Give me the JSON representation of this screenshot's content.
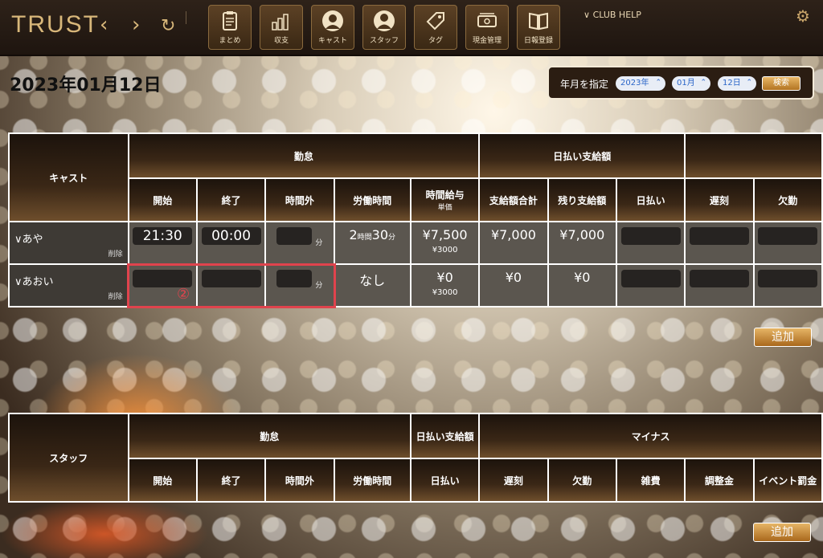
{
  "app": {
    "logo": "TRUST",
    "back": "‹",
    "forward": "›",
    "reload": "↻",
    "help": "CLUB HELP"
  },
  "toolbar": [
    {
      "label": "まとめ",
      "icon": "clipboard-icon"
    },
    {
      "label": "収支",
      "icon": "bar-chart-icon"
    },
    {
      "label": "キャスト",
      "icon": "cast-person-icon"
    },
    {
      "label": "スタッフ",
      "icon": "staff-person-icon"
    },
    {
      "label": "タグ",
      "icon": "tag-icon"
    },
    {
      "label": "現金管理",
      "icon": "cash-icon"
    },
    {
      "label": "日報登録",
      "icon": "book-icon"
    }
  ],
  "page": {
    "date_title": "2023年01月12日"
  },
  "filter": {
    "label": "年月を指定",
    "year": "2023年",
    "month": "01月",
    "day": "12日",
    "search": "検索"
  },
  "cast_table": {
    "group_headers": {
      "name": "キャスト",
      "attendance": "勤怠",
      "daily_pay": "日払い支給額"
    },
    "columns": {
      "start": "開始",
      "end": "終了",
      "overtime": "時間外",
      "work_time": "労働時間",
      "hourly": "時間給与",
      "hourly_sub": "単価",
      "total_pay": "支給額合計",
      "remaining": "残り支給額",
      "daily": "日払い",
      "late": "遅刻",
      "absence": "欠勤"
    },
    "rows": [
      {
        "name": "∨あや",
        "delete": "削除",
        "start": "21:30",
        "end": "00:00",
        "overtime": "",
        "overtime_unit": "分",
        "work_hours": "2",
        "hours_unit": "時間",
        "work_minutes": "30",
        "minutes_unit": "分",
        "hourly": "¥7,500",
        "unit_price": "¥3000",
        "total_pay": "¥7,000",
        "remaining": "¥7,000"
      },
      {
        "name": "∨あおい",
        "delete": "削除",
        "start": "",
        "end": "",
        "overtime": "",
        "overtime_unit": "分",
        "work_time": "なし",
        "hourly": "¥0",
        "unit_price": "¥3000",
        "total_pay": "¥0",
        "remaining": "¥0"
      }
    ],
    "annotation": "②",
    "add": "追加"
  },
  "staff_table": {
    "group_headers": {
      "name": "スタッフ",
      "attendance": "勤怠",
      "daily_pay": "日払い支給額",
      "minus": "マイナス"
    },
    "columns": {
      "start": "開始",
      "end": "終了",
      "overtime": "時間外",
      "work_time": "労働時間",
      "daily": "日払い",
      "late": "遅刻",
      "absence": "欠勤",
      "misc": "雑費",
      "adjust": "調整金",
      "event_fine": "イベント罰金"
    },
    "add": "追加"
  }
}
